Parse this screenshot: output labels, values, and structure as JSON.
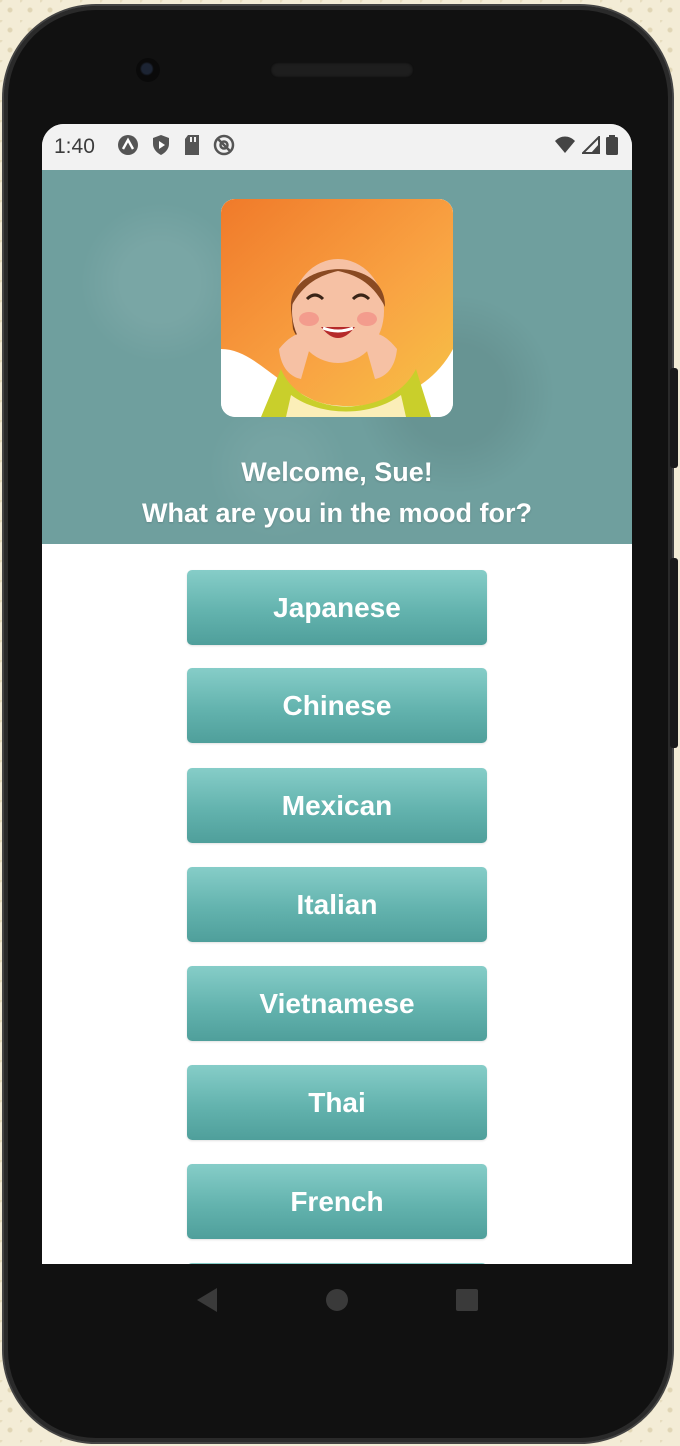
{
  "status_bar": {
    "time": "1:40",
    "left_icons": [
      "a-circle-icon",
      "shield-play-icon",
      "sd-card-icon",
      "at-circle-icon"
    ],
    "right_icons": [
      "wifi-icon",
      "signal-icon",
      "battery-icon"
    ]
  },
  "header": {
    "avatar_icon": "smiling-woman-avatar",
    "welcome_line1": "Welcome, Sue!",
    "welcome_line2": "What are you in the mood for?",
    "background_color": "#6f9f9e"
  },
  "cuisines": [
    {
      "label": "Japanese"
    },
    {
      "label": "Chinese"
    },
    {
      "label": "Mexican"
    },
    {
      "label": "Italian"
    },
    {
      "label": "Vietnamese"
    },
    {
      "label": "Thai"
    },
    {
      "label": "French"
    }
  ],
  "navigation": {
    "back_icon": "back-triangle-icon",
    "home_icon": "home-circle-icon",
    "recents_icon": "recents-square-icon"
  },
  "colors": {
    "button_top": "#86cdc8",
    "button_bottom": "#4f9f9b",
    "button_text": "#ffffff"
  }
}
